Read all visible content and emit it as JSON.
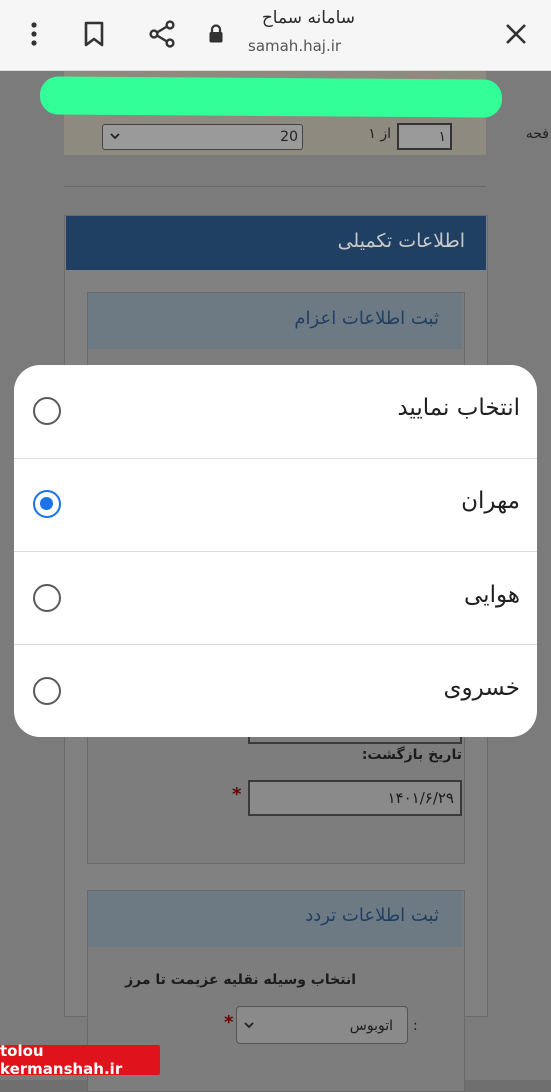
{
  "browser": {
    "site_title": "سامانه سماح",
    "site_url": "samah.haj.ir",
    "icons": [
      "more-vert-icon",
      "bookmark-icon",
      "share-icon",
      "lock-icon",
      "close-icon"
    ]
  },
  "pager": {
    "page_label": "فحه",
    "page_value": "۱",
    "of_label": "از ۱",
    "page_size": "20"
  },
  "extra_info": {
    "title": "اطلاعات تکمیلی"
  },
  "dispatch": {
    "title": "ثبت اطلاعات اعزام",
    "return_date_label": "تاریخ بازگشت:",
    "return_date_value": "۱۴۰۱/۶/۲۹",
    "required_mark": "*"
  },
  "traffic": {
    "title": "ثبت اطلاعات تردد",
    "vehicle_label": "انتخاب وسیله نقلیه عزیمت تا مرز",
    "colon": ":",
    "vehicle_value": "اتوبوس",
    "required_mark": "*"
  },
  "dialog": {
    "options": [
      {
        "label": "انتخاب نمایید",
        "selected": false
      },
      {
        "label": "مهران",
        "selected": true
      },
      {
        "label": "هوایی",
        "selected": false
      },
      {
        "label": "خسروی",
        "selected": false
      }
    ],
    "accent_color": "#1a73e8"
  },
  "watermark": {
    "text": "tolou​kermanshah.ir"
  }
}
